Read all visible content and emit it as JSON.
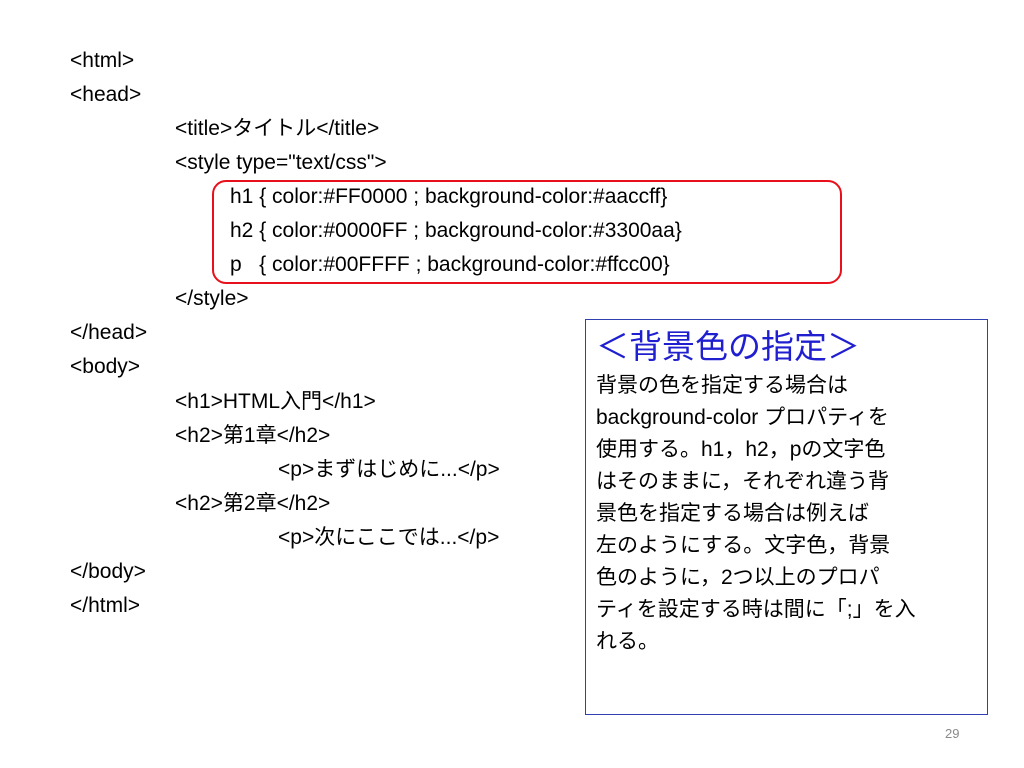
{
  "code": {
    "lines": [
      "<html>",
      "<head>",
      "<title>タイトル</title>",
      "<style type=\"text/css\">",
      "h1 { color:#FF0000 ; background-color:#aaccff}",
      "h2 { color:#0000FF ; background-color:#3300aa}",
      "p   { color:#00FFFF ; background-color:#ffcc00}",
      "</style>",
      "</head>",
      "<body>",
      "<h1>HTML入門</h1>",
      "<h2>第1章</h2>",
      "<p>まずはじめに...</p>",
      "<h2>第2章</h2>",
      "<p>次にここでは...</p>",
      "</body>",
      "</html>"
    ]
  },
  "note": {
    "title": "＜背景色の指定＞",
    "body_lines": [
      "背景の色を指定する場合は",
      "background-color プロパティを",
      "使用する。h1，h2，pの文字色",
      "はそのままに，それぞれ違う背",
      "景色を指定する場合は例えば",
      "左のようにする。文字色，背景",
      "色のように，2つ以上のプロパ",
      "ティを設定する時は間に「;」を入",
      "れる。"
    ]
  },
  "page_number": "29",
  "colors": {
    "highlight_border": "#e8101a",
    "note_border": "#3040b0",
    "note_title": "#1f1fd0"
  }
}
